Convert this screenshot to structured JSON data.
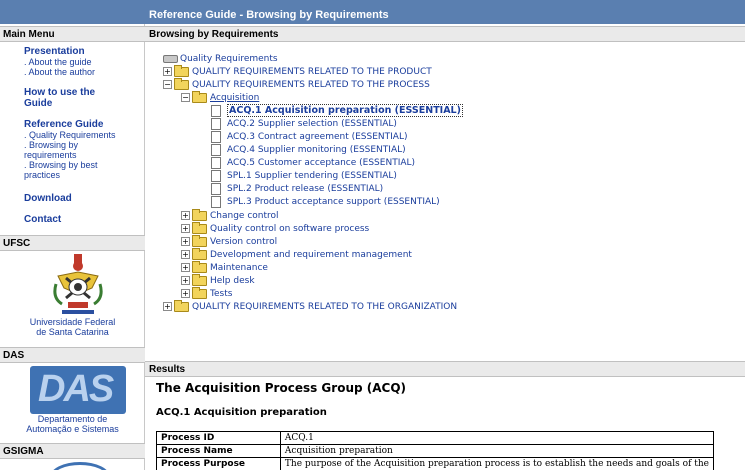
{
  "window": {
    "title": "Reference Guide - Browsing by Requirements"
  },
  "sidebar": {
    "main_menu": "Main Menu",
    "presentation": "Presentation",
    "about_guide": ". About the guide",
    "about_author": ". About the author",
    "how_to_use_1": "How to use the",
    "how_to_use_2": "Guide",
    "reference_guide": "Reference Guide",
    "quality_requirements": ". Quality Requirements",
    "browsing_req_1": ". Browsing by",
    "browsing_req_2": "requirements",
    "browsing_best_1": ". Browsing by best",
    "browsing_best_2": "practices",
    "download": "Download",
    "contact": "Contact",
    "ufsc": "UFSC",
    "ufsc_caption_1": "Universidade Federal",
    "ufsc_caption_2": "de Santa Catarina",
    "das": "DAS",
    "das_logo": "DAS",
    "das_caption_1": "Departamento de",
    "das_caption_2": "Automação e Sistemas",
    "gsigma": "GSIGMA"
  },
  "browse": {
    "heading": "Browsing by Requirements",
    "root": "Quality Requirements",
    "product": "QUALITY REQUIREMENTS RELATED TO THE PRODUCT",
    "process": "QUALITY REQUIREMENTS RELATED TO THE PROCESS",
    "acquisition": "Acquisition",
    "items": [
      "ACQ.1 Acquisition preparation (ESSENTIAL)",
      "ACQ.2 Supplier selection (ESSENTIAL)",
      "ACQ.3 Contract agreement (ESSENTIAL)",
      "ACQ.4 Supplier monitoring (ESSENTIAL)",
      "ACQ.5 Customer acceptance (ESSENTIAL)",
      "SPL.1 Supplier tendering (ESSENTIAL)",
      "SPL.2 Product release (ESSENTIAL)",
      "SPL.3 Product acceptance support (ESSENTIAL)"
    ],
    "groups": [
      "Change control",
      "Quality control on software process",
      "Version control",
      "Development and requirement management",
      "Maintenance",
      "Help desk",
      "Tests"
    ],
    "organization": "QUALITY REQUIREMENTS RELATED TO THE ORGANIZATION"
  },
  "results": {
    "heading": "Results",
    "title": "The Acquisition Process Group (ACQ)",
    "subtitle": "ACQ.1 Acquisition preparation",
    "rows": [
      {
        "k": "Process ID",
        "v": "ACQ.1"
      },
      {
        "k": "Process Name",
        "v": "Acquisition preparation"
      },
      {
        "k": "Process Purpose",
        "v": "The purpose of the Acquisition preparation process is to establish the needs and goals of the"
      }
    ]
  },
  "colors": {
    "accent": "#5a7fb0",
    "link": "#1a3d9c",
    "folder": "#f2d45c"
  }
}
